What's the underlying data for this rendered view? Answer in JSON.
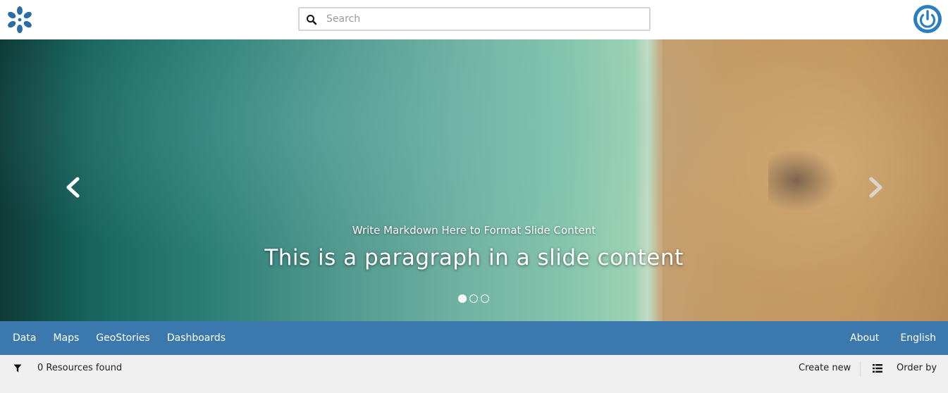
{
  "header": {
    "logo_icon": "geonode-logo-icon",
    "search": {
      "placeholder": "Search",
      "value": "",
      "icon": "search-icon"
    },
    "login_icon": "power-icon",
    "colors": {
      "brand": "#2b7ec1"
    }
  },
  "hero": {
    "subtitle": "Write Markdown Here to Format Slide Content",
    "title": "This is a paragraph in a slide content",
    "prev_icon": "chevron-left-icon",
    "next_icon": "chevron-right-icon",
    "slide_count": 3,
    "active_slide": 1
  },
  "nav": {
    "left_items": [
      {
        "label": "Data"
      },
      {
        "label": "Maps"
      },
      {
        "label": "GeoStories"
      },
      {
        "label": "Dashboards"
      }
    ],
    "right_items": [
      {
        "label": "About"
      },
      {
        "label": "English"
      }
    ],
    "colors": {
      "background": "#3a78ad"
    }
  },
  "resources": {
    "filter_icon": "filter-icon",
    "count_text": "0 Resources found",
    "create_new": "Create new",
    "list_icon": "list-view-icon",
    "order_by": "Order by"
  }
}
